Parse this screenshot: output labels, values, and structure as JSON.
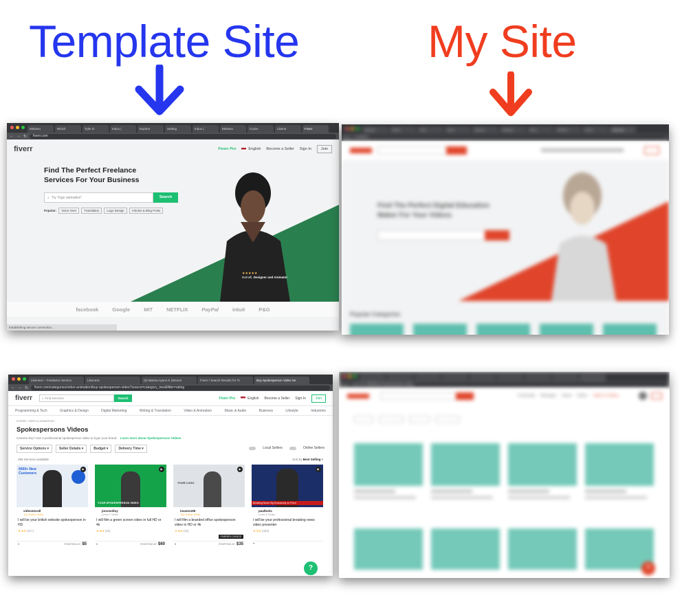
{
  "headings": {
    "left": "Template Site",
    "right": "My Site"
  },
  "colors": {
    "left_heading": "#2536ee",
    "right_heading": "#f03d1f",
    "fiverr_green": "#1dbf73",
    "hero_green": "#2a7f4f",
    "mysite_red": "#e0452b"
  },
  "shot1": {
    "tabs": [
      "MrDeeo",
      "Which",
      "Tyler D",
      "Inbox (",
      "Explore",
      "Setting",
      "Inbox (",
      "MrDeeo",
      "CUDA",
      "Likene",
      "Fiverr"
    ],
    "url": "fiverr.com",
    "logo": "fiverr",
    "nav": {
      "pro": "Fiverr Pro",
      "lang": "English",
      "seller": "Become a Seller",
      "signin": "Sign In",
      "join": "Join"
    },
    "hero_title": "Find The Perfect Freelance Services For Your Business",
    "search_placeholder": "Try \"logo animation\"",
    "search_button": "Search",
    "popular_label": "Popular:",
    "popular": [
      "Voice Over",
      "Translation",
      "Logo Design",
      "Articles & Blog Posts"
    ],
    "rating_stars": "★★★★★",
    "person_name": "Darnell,",
    "person_role": "Designer and Animator",
    "brands": [
      "facebook",
      "Google",
      "MIT",
      "NETFLIX",
      "PayPal",
      "intuit",
      "P&G"
    ],
    "status_text": "Establishing secure connection..."
  },
  "shot2": {
    "tabs": [
      "MrDeeo",
      "Which",
      "Tyler",
      "Inbox",
      "Explore",
      "Settings",
      "Inbox",
      "MrDeeo",
      "CUDA",
      "Likeness"
    ],
    "url": "localhost",
    "hero_title": "Find The Perfect Digital Education Maker For Your Videos",
    "section_title": "Popular Categories"
  },
  "shot3": {
    "tabs": [
      "Likeness – Freelance Service",
      "Likeness",
      "(5) Marina Ayano K (Steven",
      "Fiverr / Search Results for 'N",
      "Buy Spokesperson Video Se"
    ],
    "url": "fiverr.com/categories/video-animation/buy-spokesperson-video?source=category_tree&filter=rating",
    "logo": "fiverr",
    "search_placeholder": "Find Services",
    "search_button": "Search",
    "nav": {
      "pro": "Fiverr Pro",
      "lang": "English",
      "seller": "Become a Seller",
      "signin": "Sign In",
      "join": "Join"
    },
    "categories": [
      "Programming & Tech",
      "Graphics & Design",
      "Digital Marketing",
      "Writing & Translation",
      "Video & Animation",
      "Music & Audio",
      "Business",
      "Lifestyle",
      "Industries"
    ],
    "breadcrumb": "FIVERR  /  VIDEO & ANIMATION  /",
    "page_title": "Spokespersons Videos",
    "subtitle": "Camera shy? Use a professional spokesperson video to hype your brand.",
    "learn_more": "Learn more about Spokespersons Videos",
    "filters": [
      "Service Options",
      "Seller Details",
      "Budget",
      "Delivery Time"
    ],
    "toggles": [
      "Local Sellers",
      "Online Sellers"
    ],
    "count": "266 Services available",
    "sort_label": "Sort by",
    "sort_value": "Best Selling",
    "cards": [
      {
        "seller": "videostorall",
        "level": "Top Rated Seller",
        "title": "I will be your british website spokesperson in HD",
        "rating": "5.0",
        "reviews": "(1k+)",
        "starting": "STARTING AT",
        "price": "$5",
        "thumb_text": "6000+ New Customers"
      },
      {
        "seller": "joncmolloy",
        "level": "Level 2 Seller",
        "title": "I will film a green screen video in full HD or 4k",
        "rating": "5.0",
        "reviews": "(1k)",
        "starting": "STARTING AT",
        "price": "$60",
        "thumb_text": "YOUR SPOKESPERSON VIDEO"
      },
      {
        "seller": "imaston99",
        "level": "Top Rated Seller",
        "title": "I will film a branded office spokesperson video in HD or 4k",
        "rating": "5.0",
        "reviews": "(1k)",
        "starting": "STARTING AT",
        "price": "$35",
        "badge": "FIVERR'S CHOICE",
        "thumb_text": "YOUR LOGO"
      },
      {
        "seller": "paulbotic",
        "level": "Level 2 Seller",
        "title": "I will be your professional breaking news video presenter",
        "rating": "5.0",
        "reviews": "(492)",
        "starting": "STARTING AT",
        "price": "",
        "thumb_text": "Breaking News Gig Exclusively on Fiverr"
      }
    ],
    "help": "?"
  },
  "shot4": {
    "url": "127.0.0.1:8000/buy?spokesperson-video",
    "nav": [
      "Community",
      "Messages",
      "Saved",
      "Orders",
      "Switch to Selling"
    ],
    "help": "?"
  }
}
